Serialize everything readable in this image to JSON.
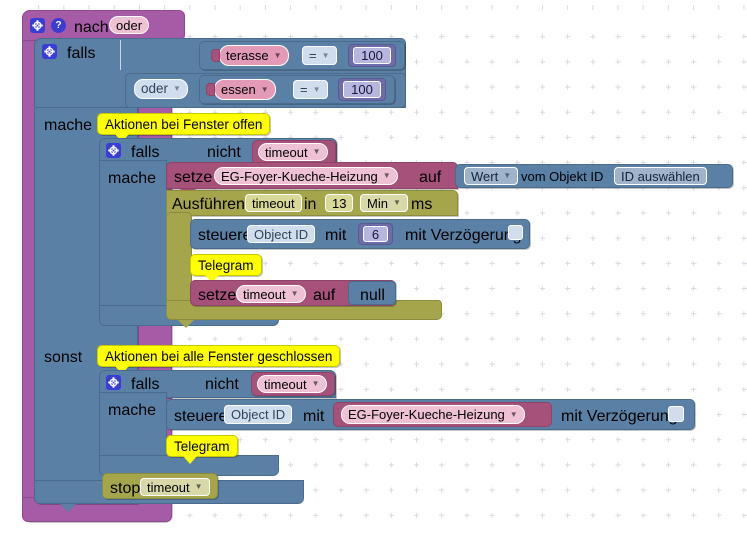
{
  "editor": {
    "name": "blockly-workspace",
    "background": "#ffffff",
    "grid_color": "#d9d9e2"
  },
  "colors": {
    "hat_purple": "#a55ba5",
    "control_blue": "#5b80a5",
    "variable_pink": "#a5517a",
    "timer_olive": "#a5a54b",
    "comment_yellow": "#ffff00",
    "icon_blue": "#3b3bd6"
  },
  "blocks": {
    "hat": {
      "label": "nach",
      "mode": "oder",
      "gear_icon": "gear-icon",
      "help_icon": "question-icon"
    },
    "if_outer": {
      "keyword": "falls",
      "do_label": "mache",
      "else_label": "sonst",
      "gear_icon": "gear-icon",
      "join_operator": "oder"
    },
    "condition_1": {
      "variable": "terasse",
      "operator": "=",
      "value": "100"
    },
    "condition_2": {
      "variable": "essen",
      "operator": "=",
      "value": "100"
    },
    "comment_open": "Aktionen bei Fenster offen",
    "comment_closed": "Aktionen bei alle Fenster geschlossen",
    "if_inner_open": {
      "keyword": "falls",
      "not_label": "nicht",
      "condition_variable": "timeout",
      "do_label": "mache",
      "gear_icon": "gear-icon"
    },
    "set_block": {
      "keyword": "setze",
      "target": "EG-Foyer-Kueche-Heizung",
      "to_label": "auf"
    },
    "get_value_block": {
      "property": "Wert",
      "of_label": "vom Objekt ID",
      "object_id": "ID auswählen"
    },
    "timeout_block": {
      "keyword": "Ausführen",
      "name": "timeout",
      "in_label": "in",
      "amount": "13",
      "unit": "Min",
      "unit_suffix": "ms"
    },
    "control_block_open": {
      "keyword": "steuere",
      "object_id": "Object ID",
      "with_label": "mit",
      "value": "6",
      "delay_label": "mit Verzögerung",
      "delay_checkbox": false
    },
    "telegram_open": "Telegram",
    "set_timeout_null": {
      "keyword": "setze",
      "variable": "timeout",
      "to_label": "auf",
      "value": "null"
    },
    "if_inner_closed": {
      "keyword": "falls",
      "not_label": "nicht",
      "condition_variable": "timeout",
      "do_label": "mache",
      "gear_icon": "gear-icon"
    },
    "control_block_closed": {
      "keyword": "steuere",
      "object_id": "Object ID",
      "with_label": "mit",
      "value": "EG-Foyer-Kueche-Heizung",
      "delay_label": "mit Verzögerung",
      "delay_checkbox": false
    },
    "telegram_closed": "Telegram",
    "stop_block": {
      "keyword": "stop",
      "timer": "timeout"
    }
  }
}
